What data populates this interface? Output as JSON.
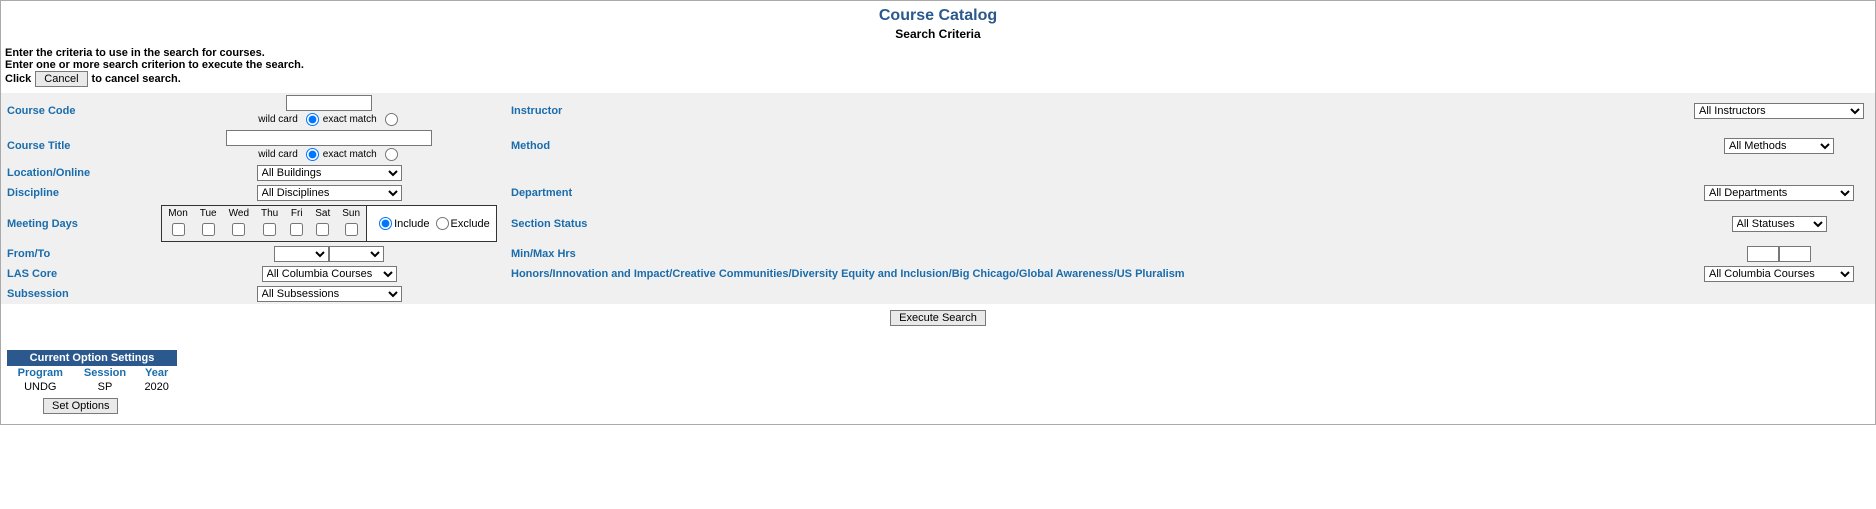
{
  "header": {
    "title": "Course Catalog",
    "subtitle": "Search Criteria"
  },
  "intro": {
    "line1": "Enter the criteria to use in the search for courses.",
    "line2": "Enter one or more search criterion to execute the search.",
    "click_word": "Click",
    "cancel_btn": "Cancel",
    "after_cancel": "to cancel search."
  },
  "labels": {
    "course_code": "Course Code",
    "course_title": "Course Title",
    "location_online": "Location/Online",
    "discipline": "Discipline",
    "meeting_days": "Meeting Days",
    "from_to": "From/To",
    "las_core": "LAS Core",
    "subsession": "Subsession",
    "instructor": "Instructor",
    "method": "Method",
    "department": "Department",
    "section_status": "Section Status",
    "min_max_hrs": "Min/Max Hrs",
    "honors": "Honors/Innovation and Impact/Creative Communities/Diversity Equity and Inclusion/Big Chicago/Global Awareness/US Pluralism"
  },
  "radio": {
    "wild_card": "wild card",
    "exact_match": "exact match",
    "include": "Include",
    "exclude": "Exclude"
  },
  "days": {
    "mon": "Mon",
    "tue": "Tue",
    "wed": "Wed",
    "thu": "Thu",
    "fri": "Fri",
    "sat": "Sat",
    "sun": "Sun"
  },
  "selects": {
    "all_buildings": "All Buildings",
    "all_disciplines": "All Disciplines",
    "all_columbia_courses": "All Columbia Courses",
    "all_subsessions": "All Subsessions",
    "all_instructors": "All Instructors",
    "all_methods": "All Methods",
    "all_departments": "All Departments",
    "all_statuses": "All Statuses"
  },
  "buttons": {
    "execute_search": "Execute Search",
    "set_options": "Set Options"
  },
  "option_settings": {
    "caption": "Current Option Settings",
    "program_h": "Program",
    "session_h": "Session",
    "year_h": "Year",
    "program_v": "UNDG",
    "session_v": "SP",
    "year_v": "2020"
  }
}
